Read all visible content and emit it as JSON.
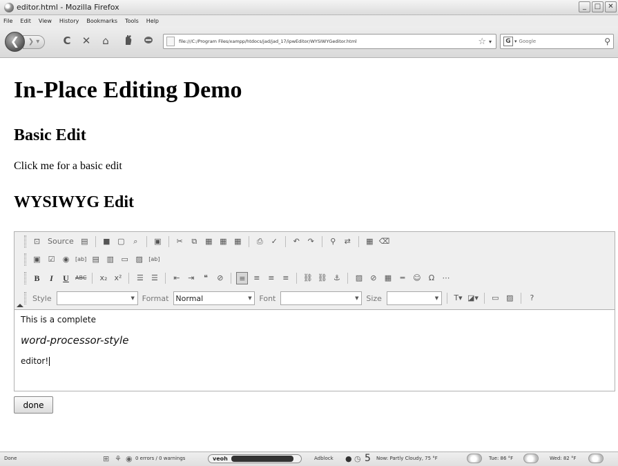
{
  "window": {
    "title": "editor.html - Mozilla Firefox",
    "controls": [
      "_",
      "□",
      "✕"
    ]
  },
  "menu": [
    "File",
    "Edit",
    "View",
    "History",
    "Bookmarks",
    "Tools",
    "Help"
  ],
  "navbar": {
    "back": "❮",
    "forward": "❯ ▾",
    "reload": "C",
    "stop": "✕",
    "home": "⌂",
    "url": "file:///C:/Program Files/xampp/htdocs/jad/jad_17/ipwEditor/WYSIWYGeditor.html",
    "bookmark_star": "☆",
    "url_dropdown": "▾",
    "search_engine": "G",
    "search_dropdown": "▾",
    "search_placeholder": "Google",
    "search_go": "⚲"
  },
  "page": {
    "title": "In-Place Editing Demo",
    "basic_heading": "Basic Edit",
    "basic_text": "Click me for a basic edit",
    "wysiwyg_heading": "WYSIWYG Edit"
  },
  "editor": {
    "source_label": "Source",
    "style_label": "Style",
    "style_value": "",
    "format_label": "Format",
    "format_value": "Normal",
    "font_label": "Font",
    "font_value": "",
    "size_label": "Size",
    "size_value": "",
    "buttons": {
      "bold": "B",
      "italic": "I",
      "underline": "U",
      "strike": "ABC",
      "subscript": "x₂",
      "superscript": "x²"
    },
    "content": {
      "line1": "This is a complete",
      "line2": "word-processor-style",
      "line3": "editor!"
    }
  },
  "done_label": "done",
  "status": {
    "left": "Done",
    "errors": "0 errors / 0 warnings",
    "veoh": "veoh",
    "adblock": "Adblock",
    "count": "5",
    "now": "Now: Partly Cloudy, 75 °F",
    "tue": "Tue: 86 °F",
    "wed": "Wed: 82 °F"
  }
}
